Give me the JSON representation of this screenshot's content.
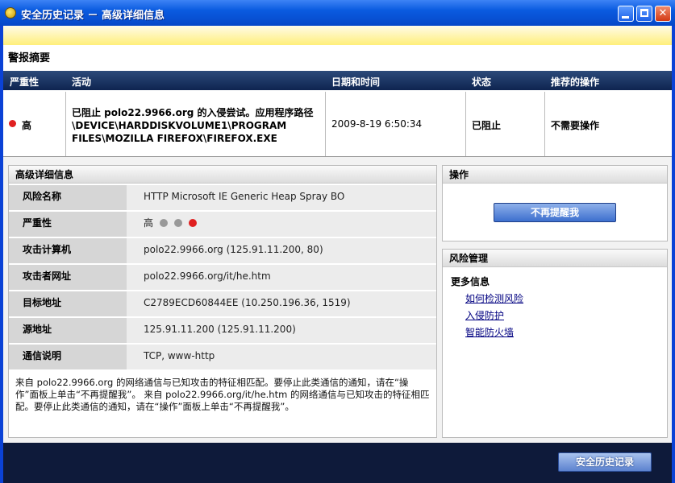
{
  "window": {
    "title": "安全历史记录 － 高级详细信息"
  },
  "summary": {
    "title": "警报摘要",
    "columns": [
      "严重性",
      "活动",
      "日期和时间",
      "状态",
      "推荐的操作"
    ],
    "row": {
      "severity": "高",
      "activity": "已阻止 polo22.9966.org 的入侵尝试。应用程序路径 \\DEVICE\\HARDDISKVOLUME1\\PROGRAM FILES\\MOZILLA FIREFOX\\FIREFOX.EXE",
      "datetime": "2009-8-19 6:50:34",
      "status": "已阻止",
      "recommended": "不需要操作"
    }
  },
  "advanced": {
    "title": "高级详细信息",
    "rows": [
      {
        "label": "风险名称",
        "value": "HTTP Microsoft IE Generic Heap Spray BO"
      },
      {
        "label": "严重性",
        "value": "高"
      },
      {
        "label": "攻击计算机",
        "value": "polo22.9966.org (125.91.11.200, 80)"
      },
      {
        "label": "攻击者网址",
        "value": "polo22.9966.org/it/he.htm"
      },
      {
        "label": "目标地址",
        "value": "C2789ECD60844EE (10.250.196.36, 1519)"
      },
      {
        "label": "源地址",
        "value": "125.91.11.200 (125.91.11.200)"
      },
      {
        "label": "通信说明",
        "value": "TCP, www-http"
      }
    ],
    "severity_dots": [
      "#999999",
      "#999999",
      "#e02020"
    ],
    "description": "来自 polo22.9966.org 的网络通信与已知攻击的特征相匹配。要停止此类通信的通知，请在“操作”面板上单击“不再提醒我”。 来自 polo22.9966.org/it/he.htm 的网络通信与已知攻击的特征相匹配。要停止此类通信的通知，请在“操作”面板上单击“不再提醒我”。"
  },
  "actions": {
    "title": "操作",
    "dismiss_button": "不再提醒我"
  },
  "risk": {
    "title": "风险管理",
    "more_info": "更多信息",
    "links": [
      "如何检测风险",
      "入侵防护",
      "智能防火墙"
    ]
  },
  "footer": {
    "history_button": "安全历史记录"
  },
  "colors": {
    "title_bar": "#0a5be0",
    "header_bar": "#0e2450",
    "danger": "#e02020",
    "link": "#000080"
  }
}
